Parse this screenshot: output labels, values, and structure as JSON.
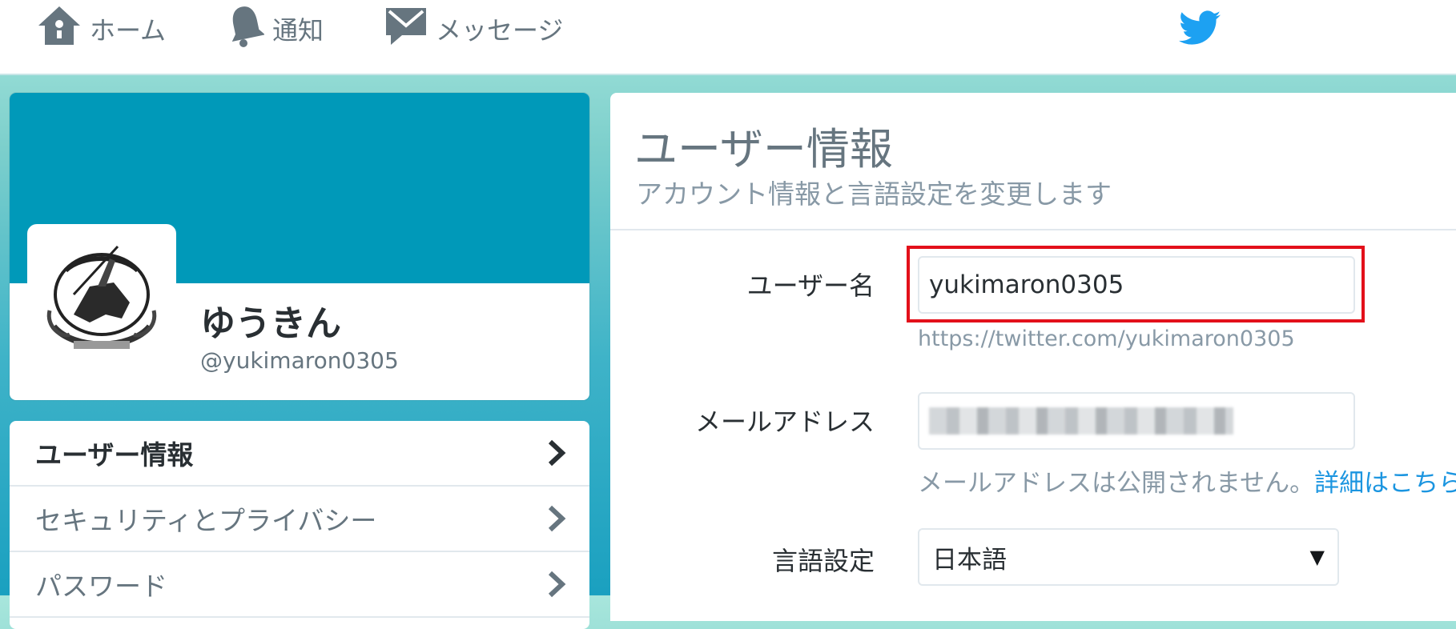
{
  "nav": {
    "home_label": "ホーム",
    "notifications_label": "通知",
    "messages_label": "メッセージ"
  },
  "colors": {
    "brand": "#1da1f2",
    "banner": "#0099b9",
    "highlight": "#e3101a",
    "link": "#1b95e0"
  },
  "profile": {
    "name": "ゆうきん",
    "handle": "@yukimaron0305"
  },
  "menu": {
    "items": [
      {
        "label": "ユーザー情報",
        "active": true
      },
      {
        "label": "セキュリティとプライバシー",
        "active": false
      },
      {
        "label": "パスワード",
        "active": false
      }
    ]
  },
  "main": {
    "title": "ユーザー情報",
    "subtitle": "アカウント情報と言語設定を変更します",
    "username_label": "ユーザー名",
    "username_value": "yukimaron0305",
    "username_url": "https://twitter.com/yukimaron0305",
    "email_label": "メールアドレス",
    "email_help": "メールアドレスは公開されません。",
    "email_help_link": "詳細はこちら。",
    "language_label": "言語設定",
    "language_value": "日本語"
  }
}
